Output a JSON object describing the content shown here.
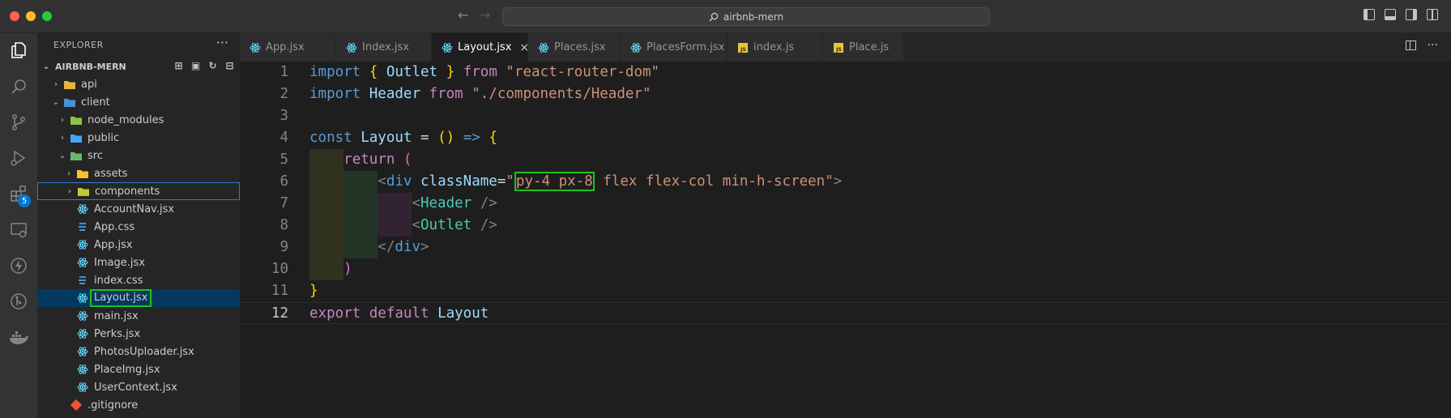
{
  "titlebar": {
    "search_text": "airbnb-mern",
    "lights": [
      "#ff5f57",
      "#febc2e",
      "#28c840"
    ]
  },
  "activity_bar": {
    "items": [
      "files-icon",
      "search-icon",
      "source-control-icon",
      "run-debug-icon",
      "extensions-icon",
      "remote-explorer-icon",
      "lightning-icon",
      "git-graph-icon",
      "docker-icon"
    ],
    "extensions_badge": "5"
  },
  "sidebar": {
    "title": "EXPLORER",
    "project": "AIRBNB-MERN",
    "tree": [
      {
        "label": "api",
        "depth": 1,
        "type": "folder",
        "icon": "folder-icon",
        "chevron": "›",
        "color": "#e8b23f"
      },
      {
        "label": "client",
        "depth": 1,
        "type": "folder",
        "icon": "folder-icon",
        "chevron": "⌄",
        "color": "#4a90d9"
      },
      {
        "label": "node_modules",
        "depth": 2,
        "type": "folder",
        "icon": "folder-icon",
        "chevron": "›",
        "color": "#8bc34a"
      },
      {
        "label": "public",
        "depth": 2,
        "type": "folder",
        "icon": "folder-icon",
        "chevron": "›",
        "color": "#42a5f5"
      },
      {
        "label": "src",
        "depth": 2,
        "type": "folder",
        "icon": "folder-icon",
        "chevron": "⌄",
        "color": "#66bb6a"
      },
      {
        "label": "assets",
        "depth": 3,
        "type": "folder",
        "icon": "folder-icon",
        "chevron": "›",
        "color": "#fbc02d"
      },
      {
        "label": "components",
        "depth": 3,
        "type": "folder",
        "icon": "folder-icon",
        "chevron": "›",
        "color": "#c0ca33",
        "highlight": true
      },
      {
        "label": "AccountNav.jsx",
        "depth": 3,
        "type": "file",
        "icon": "react-icon",
        "color": "#61dafb"
      },
      {
        "label": "App.css",
        "depth": 3,
        "type": "file",
        "icon": "css-icon",
        "color": "#42a5f5"
      },
      {
        "label": "App.jsx",
        "depth": 3,
        "type": "file",
        "icon": "react-icon",
        "color": "#61dafb"
      },
      {
        "label": "Image.jsx",
        "depth": 3,
        "type": "file",
        "icon": "react-icon",
        "color": "#61dafb"
      },
      {
        "label": "index.css",
        "depth": 3,
        "type": "file",
        "icon": "css-icon",
        "color": "#42a5f5"
      },
      {
        "label": "Layout.jsx",
        "depth": 3,
        "type": "file",
        "icon": "react-icon",
        "color": "#61dafb",
        "selected": true
      },
      {
        "label": "main.jsx",
        "depth": 3,
        "type": "file",
        "icon": "react-icon",
        "color": "#61dafb"
      },
      {
        "label": "Perks.jsx",
        "depth": 3,
        "type": "file",
        "icon": "react-icon",
        "color": "#61dafb"
      },
      {
        "label": "PhotosUploader.jsx",
        "depth": 3,
        "type": "file",
        "icon": "react-icon",
        "color": "#61dafb"
      },
      {
        "label": "PlaceImg.jsx",
        "depth": 3,
        "type": "file",
        "icon": "react-icon",
        "color": "#61dafb"
      },
      {
        "label": "UserContext.jsx",
        "depth": 3,
        "type": "file",
        "icon": "react-icon",
        "color": "#61dafb"
      },
      {
        "label": ".gitignore",
        "depth": 2,
        "type": "file",
        "icon": "git-icon",
        "color": "#f05133"
      }
    ]
  },
  "tabs": [
    {
      "label": "App.jsx",
      "icon": "react-icon"
    },
    {
      "label": "Index.jsx",
      "icon": "react-icon"
    },
    {
      "label": "Layout.jsx",
      "icon": "react-icon",
      "active": true
    },
    {
      "label": "Places.jsx",
      "icon": "react-icon"
    },
    {
      "label": "PlacesForm.jsx",
      "icon": "react-icon"
    },
    {
      "label": "index.js",
      "icon": "js-icon"
    },
    {
      "label": "Place.js",
      "icon": "js-icon"
    }
  ],
  "editor": {
    "current_line": 12,
    "lines": [
      {
        "n": "1",
        "tokens": [
          [
            "import",
            "b"
          ],
          [
            " ",
            "w"
          ],
          [
            "{",
            "p"
          ],
          [
            " ",
            "w"
          ],
          [
            "Outlet",
            "v"
          ],
          [
            " ",
            "w"
          ],
          [
            "}",
            "p"
          ],
          [
            " ",
            "w"
          ],
          [
            "from",
            "k"
          ],
          [
            " ",
            "w"
          ],
          [
            "\"react-router-dom\"",
            "s"
          ]
        ]
      },
      {
        "n": "2",
        "tokens": [
          [
            "import",
            "b"
          ],
          [
            " ",
            "w"
          ],
          [
            "Header",
            "v"
          ],
          [
            " ",
            "w"
          ],
          [
            "from",
            "k"
          ],
          [
            " ",
            "w"
          ],
          [
            "\"./components/Header\"",
            "s"
          ]
        ]
      },
      {
        "n": "3",
        "tokens": []
      },
      {
        "n": "4",
        "tokens": [
          [
            "const",
            "b"
          ],
          [
            " ",
            "w"
          ],
          [
            "Layout",
            "v"
          ],
          [
            " ",
            "w"
          ],
          [
            "=",
            "op"
          ],
          [
            " ",
            "w"
          ],
          [
            "()",
            "p"
          ],
          [
            " ",
            "w"
          ],
          [
            "=>",
            "b"
          ],
          [
            " ",
            "w"
          ],
          [
            "{",
            "p"
          ]
        ]
      },
      {
        "n": "5",
        "tokens": [
          [
            "    ",
            "w"
          ],
          [
            "return",
            "k"
          ],
          [
            " ",
            "w"
          ],
          [
            "(",
            "pu"
          ]
        ]
      },
      {
        "n": "6",
        "tokens": [
          [
            "        ",
            "w"
          ],
          [
            "<",
            "t"
          ],
          [
            "div",
            "b"
          ],
          [
            " ",
            "w"
          ],
          [
            "className",
            "at"
          ],
          [
            "=",
            "w"
          ],
          [
            "\"",
            "s"
          ],
          [
            "py-4 px-8",
            "s",
            "box"
          ],
          [
            " flex flex-col min-h-screen\"",
            "s"
          ],
          [
            ">",
            "t"
          ]
        ]
      },
      {
        "n": "7",
        "tokens": [
          [
            "            ",
            "w"
          ],
          [
            "<",
            "t"
          ],
          [
            "Header",
            "tg"
          ],
          [
            " ",
            "w"
          ],
          [
            "/>",
            "t"
          ]
        ]
      },
      {
        "n": "8",
        "tokens": [
          [
            "            ",
            "w"
          ],
          [
            "<",
            "t"
          ],
          [
            "Outlet",
            "tg"
          ],
          [
            " ",
            "w"
          ],
          [
            "/>",
            "t"
          ]
        ]
      },
      {
        "n": "9",
        "tokens": [
          [
            "        ",
            "w"
          ],
          [
            "</",
            "t"
          ],
          [
            "div",
            "b"
          ],
          [
            ">",
            "t"
          ]
        ]
      },
      {
        "n": "10",
        "tokens": [
          [
            "    ",
            "w"
          ],
          [
            ")",
            "pu"
          ]
        ]
      },
      {
        "n": "11",
        "tokens": [
          [
            "}",
            "p"
          ]
        ]
      },
      {
        "n": "12",
        "tokens": [
          [
            "export",
            "k"
          ],
          [
            " ",
            "w"
          ],
          [
            "default",
            "k"
          ],
          [
            " ",
            "w"
          ],
          [
            "Layout",
            "v"
          ]
        ]
      }
    ]
  }
}
